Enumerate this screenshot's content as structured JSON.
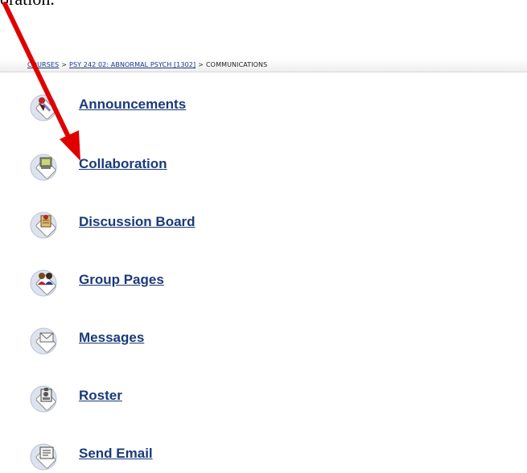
{
  "top_text": "oration.",
  "breadcrumb": {
    "items": [
      {
        "label": "COURSES",
        "link": true
      },
      {
        "label": "PSY 242 02: ABNORMAL PSYCH [1302]",
        "link": true
      },
      {
        "label": "COMMUNICATIONS",
        "link": false
      }
    ],
    "separator": ">"
  },
  "menu": {
    "items": [
      {
        "label": "Announcements",
        "icon": "announcements-icon"
      },
      {
        "label": "Collaboration",
        "icon": "collaboration-icon"
      },
      {
        "label": "Discussion Board",
        "icon": "discussion-board-icon"
      },
      {
        "label": "Group Pages",
        "icon": "group-pages-icon"
      },
      {
        "label": "Messages",
        "icon": "messages-icon"
      },
      {
        "label": "Roster",
        "icon": "roster-icon"
      },
      {
        "label": "Send Email",
        "icon": "send-email-icon"
      }
    ]
  },
  "colors": {
    "link": "#1a3a7a",
    "arrow": "#e00000"
  }
}
